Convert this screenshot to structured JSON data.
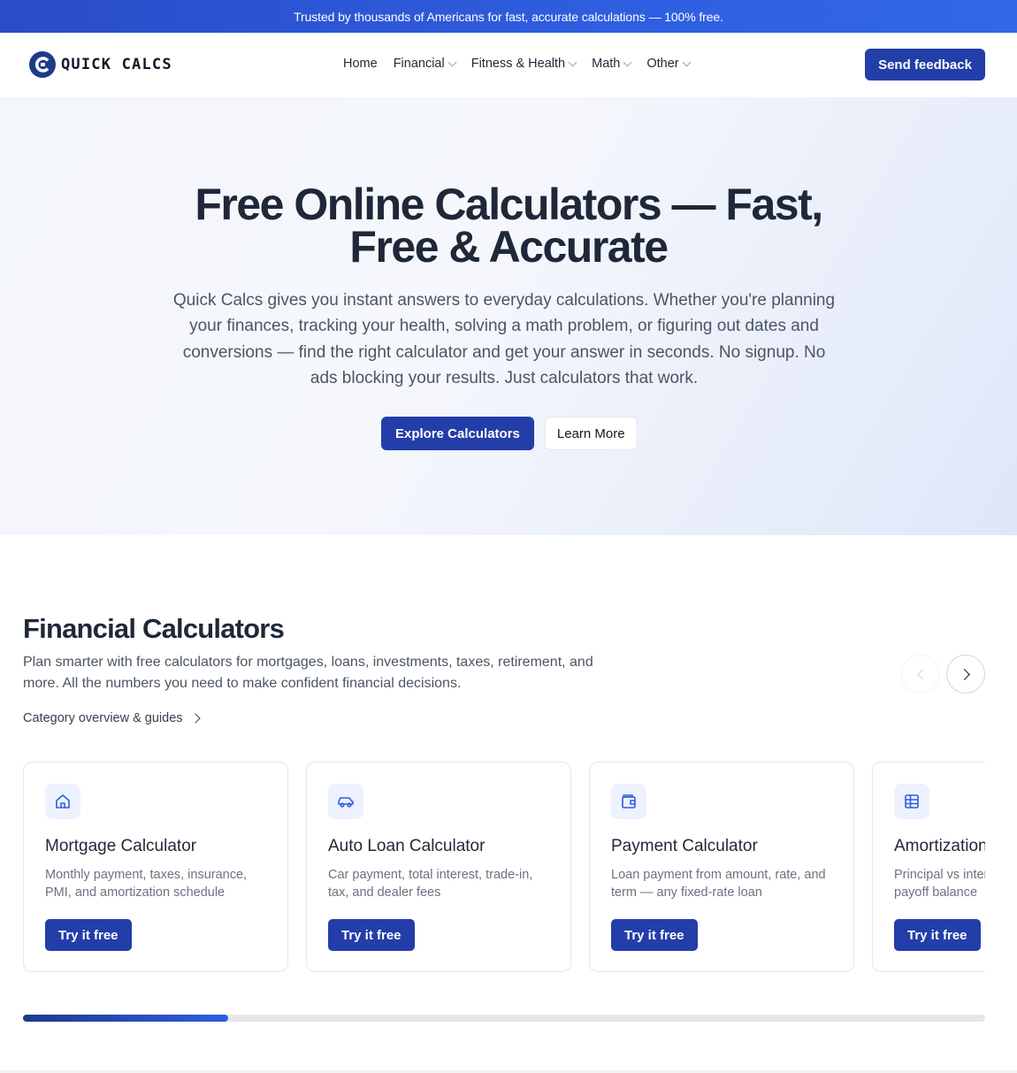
{
  "banner": {
    "text": "Trusted by thousands of Americans for fast, accurate calculations — 100% free."
  },
  "header": {
    "logo_text": "QUICK CALCS",
    "nav": [
      {
        "label": "Home",
        "has_dropdown": false
      },
      {
        "label": "Financial",
        "has_dropdown": true
      },
      {
        "label": "Fitness & Health",
        "has_dropdown": true
      },
      {
        "label": "Math",
        "has_dropdown": true
      },
      {
        "label": "Other",
        "has_dropdown": true
      }
    ],
    "feedback_label": "Send feedback"
  },
  "hero": {
    "title_line1": "Free Online Calculators — Fast,",
    "title_line2": "Free & Accurate",
    "subtitle": "Quick Calcs gives you instant answers to everyday calculations. Whether you're planning your finances, tracking your health, solving a math problem, or figuring out dates and conversions — find the right calculator and get your answer in seconds. No signup. No ads blocking your results. Just calculators that work.",
    "primary_cta": "Explore Calculators",
    "secondary_cta": "Learn More"
  },
  "financial": {
    "title": "Financial Calculators",
    "description": "Plan smarter with free calculators for mortgages, loans, investments, taxes, retirement, and more. All the numbers you need to make confident financial decisions.",
    "overview_link": "Category overview & guides",
    "cards": [
      {
        "icon": "home-icon",
        "title": "Mortgage Calculator",
        "desc": "Monthly payment, taxes, insurance, PMI, and amortization schedule",
        "cta": "Try it free"
      },
      {
        "icon": "car-icon",
        "title": "Auto Loan Calculator",
        "desc": "Car payment, total interest, trade-in, tax, and dealer fees",
        "cta": "Try it free"
      },
      {
        "icon": "wallet-icon",
        "title": "Payment Calculator",
        "desc": "Loan payment from amount, rate, and term — any fixed-rate loan",
        "cta": "Try it free"
      },
      {
        "icon": "table-icon",
        "title": "Amortization Calculator",
        "desc": "Principal vs interest over time and payoff balance",
        "cta": "Try it free"
      }
    ],
    "carousel_progress": 0.213
  },
  "colors": {
    "brand": "#233ea8",
    "banner": "#2f5ee0",
    "text": "#1e2838"
  }
}
